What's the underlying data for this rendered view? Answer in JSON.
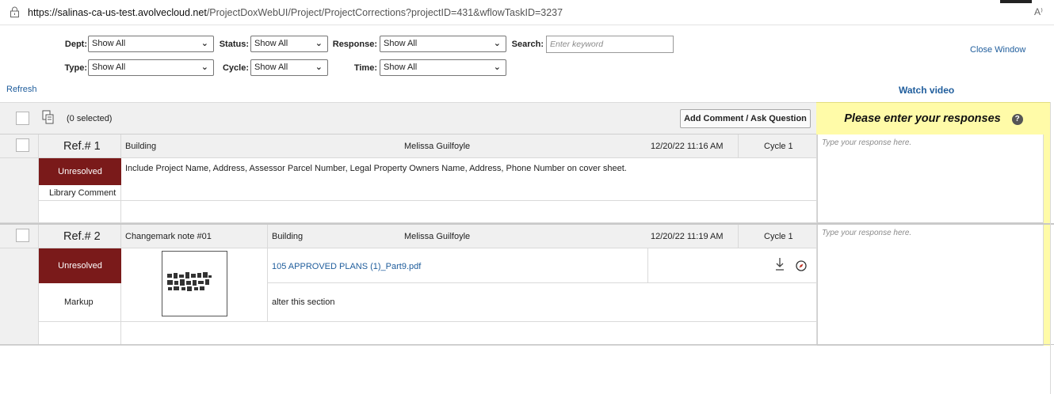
{
  "browser": {
    "url_host": "https://salinas-ca-us-test.avolvecloud.net",
    "url_path": "/ProjectDoxWebUI/Project/ProjectCorrections?projectID=431&wflowTaskID=3237",
    "read_aloud": "A⁾"
  },
  "filters": {
    "dept": {
      "label": "Dept:",
      "value": "Show All"
    },
    "status": {
      "label": "Status:",
      "value": "Show All"
    },
    "response": {
      "label": "Response:",
      "value": "Show All"
    },
    "search": {
      "label": "Search:",
      "placeholder": "Enter keyword"
    },
    "type": {
      "label": "Type:",
      "value": "Show All"
    },
    "cycle": {
      "label": "Cycle:",
      "value": "Show All"
    },
    "time": {
      "label": "Time:",
      "value": "Show All"
    }
  },
  "links": {
    "close_window": "Close Window",
    "refresh": "Refresh",
    "watch_video": "Watch video"
  },
  "toolbar": {
    "selected_count": "(0 selected)",
    "add_comment": "Add Comment / Ask Question",
    "responses_heading": "Please enter your responses",
    "help": "?"
  },
  "rows": [
    {
      "ref": "Ref.# 1",
      "category": "Building",
      "author": "Melissa Guilfoyle",
      "date": "12/20/22 11:16 AM",
      "cycle": "Cycle 1",
      "status": "Unresolved",
      "kind": "Library Comment",
      "comment": "Include Project Name, Address, Assessor Parcel Number, Legal Property Owners Name, Address, Phone Number on cover sheet.",
      "response_placeholder": "Type your response here."
    },
    {
      "ref": "Ref.# 2",
      "title": "Changemark note #01",
      "category": "Building",
      "author": "Melissa Guilfoyle",
      "date": "12/20/22 11:19 AM",
      "cycle": "Cycle 1",
      "status": "Unresolved",
      "kind": "Markup",
      "file": "105 APPROVED PLANS (1)_Part9.pdf",
      "comment": "alter this section",
      "response_placeholder": "Type your response here."
    }
  ]
}
